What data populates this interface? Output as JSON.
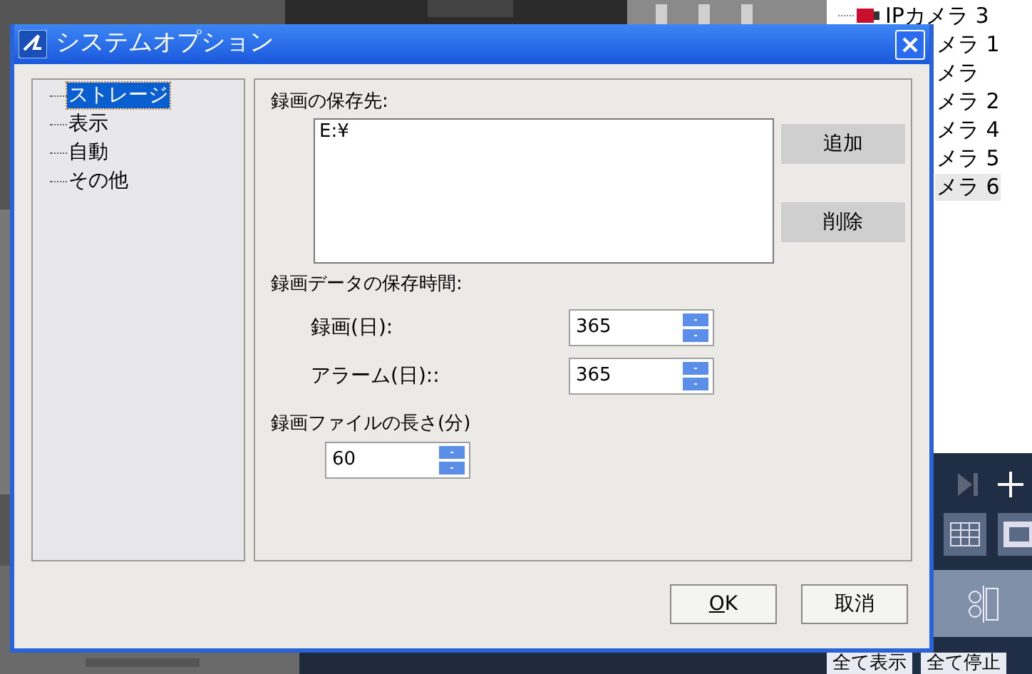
{
  "camera_tree": [
    {
      "label": "IPカメラ 3",
      "kind": "camera",
      "selected": false
    },
    {
      "label": "メラ 1",
      "kind": "text",
      "selected": false
    },
    {
      "label": "メラ",
      "kind": "text",
      "selected": false
    },
    {
      "label": "メラ 2",
      "kind": "text",
      "selected": false
    },
    {
      "label": "メラ 4",
      "kind": "text",
      "selected": false
    },
    {
      "label": "メラ 5",
      "kind": "text",
      "selected": false
    },
    {
      "label": "メラ 6",
      "kind": "text",
      "selected": true
    }
  ],
  "bottom_buttons": [
    "全て表示",
    "全て停止"
  ],
  "dialog": {
    "title": "システムオプション",
    "tree": [
      {
        "label": "ストレージ",
        "selected": true
      },
      {
        "label": "表示",
        "selected": false
      },
      {
        "label": "自動",
        "selected": false
      },
      {
        "label": "その他",
        "selected": false
      }
    ],
    "storage": {
      "label": "録画の保存先:",
      "paths": [
        "E:¥"
      ],
      "add_button": "追加",
      "delete_button": "削除"
    },
    "retention": {
      "label": "録画データの保存時間:",
      "fields": [
        {
          "label": "録画(日):",
          "value": "365"
        },
        {
          "label": "アラーム(日)::",
          "value": "365"
        }
      ]
    },
    "file_length": {
      "label": "録画ファイルの長さ(分)",
      "value": "60"
    },
    "buttons": [
      {
        "label": "OK",
        "underline_first": true
      },
      {
        "label": "取消",
        "underline_first": false
      }
    ]
  }
}
